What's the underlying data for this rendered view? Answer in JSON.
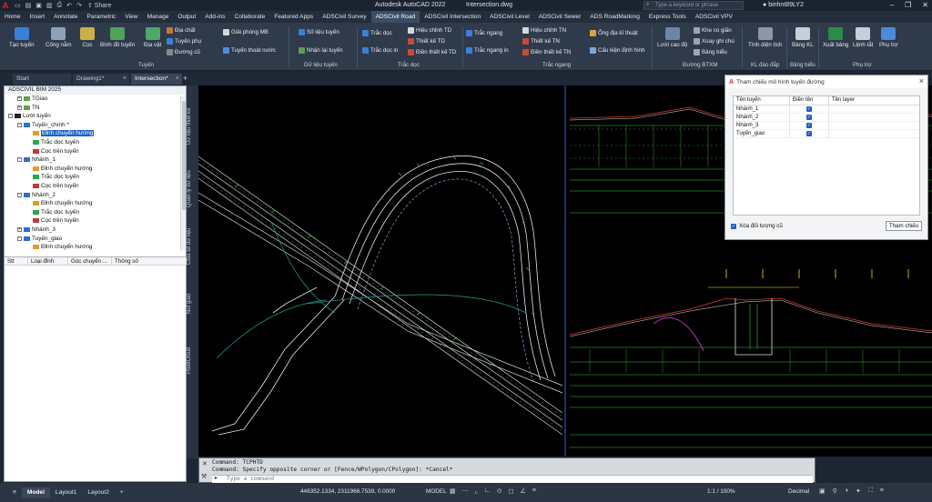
{
  "app": {
    "title": "Autodesk AutoCAD 2022",
    "file": "Intersection.dwg",
    "share": "Share",
    "search_placeholder": "Type a keyword or phrase",
    "user": "binhnt89LY2"
  },
  "ribbon_tabs": [
    "Home",
    "Insert",
    "Annotate",
    "Parametric",
    "View",
    "Manage",
    "Output",
    "Add-ins",
    "Collaborate",
    "Featured Apps",
    "ADSCivil Survey",
    "ADSCivil Road",
    "ADSCivil Intersection",
    "ADSCivil Level",
    "ADSCivil Sewer",
    "ADS RoadMarking",
    "Express Tools",
    "ADSCivil VPV"
  ],
  "active_ribbon_tab": "ADSCivil Road",
  "ribbon": {
    "tao_tuyen": "Tạo tuyến",
    "cong_nam": "Cống nằm",
    "coc": "Cọc",
    "binh_do_tuyen": "Bình đồ tuyến",
    "dia_vat": "Địa vật",
    "dia_chat": "Địa chất",
    "tuyen_phu": "Tuyến phụ",
    "duong_cu": "Đường cũ",
    "giai_phong_mb": "Giải phóng MB",
    "tuyen_thoat_nuoc": "Tuyến thoát nước",
    "so_lieu_tuyen": "Số liệu tuyến",
    "nhan_lai_tuyen": "Nhận lại tuyến",
    "trac_doc": "Trắc dọc",
    "trac_doc_in": "Trắc dọc in",
    "hieu_chinh_td": "Hiệu chỉnh TD",
    "thiet_ke_td": "Thiết kế TD",
    "dien_thiet_ke_td": "Điền thiết kế TD",
    "trac_ngang": "Trắc ngang",
    "trac_ngang_in": "Trắc ngang in",
    "hieu_chinh_tn": "Hiệu chỉnh TN",
    "thiet_ke_tn": "Thiết kế TN",
    "dien_thiet_ke_tn": "Điền thiết kế TN",
    "ong_dia_ki_thuat": "Ống địa kĩ thuật",
    "cau_kien_dinh_hinh": "Cấu kiện định hình",
    "luoi_cao_do": "Lưới cao độ",
    "khe_co_gian": "Khe co giãn",
    "xoay_ghi_chu": "Xoay ghi chú",
    "bang_bieu": "Bảng biểu",
    "tinh_dien_tich": "Tính diện tích",
    "bang_kl": "Bảng KL",
    "xuat_bang": "Xuất bảng",
    "lenh_tat": "Lệnh tắt",
    "phu_tro": "Phụ trợ",
    "groups": {
      "tuyen": "Tuyến",
      "du_lieu_tuyen": "Dữ liệu tuyến",
      "trac_doc": "Trắc dọc",
      "trac_ngang": "Trắc ngang",
      "duong_btxm": "Đường BTXM",
      "kl_dao_dap": "KL đào đắp",
      "bang_bieu": "Bảng biểu",
      "phu_tro": "Phụ trợ"
    }
  },
  "doc_tabs": [
    "Start",
    "Drawing1*",
    "Intersection*"
  ],
  "active_doc_tab": "Intersection*",
  "left_panel": {
    "title": "ADSCIVIL BIM 2025",
    "tree": [
      {
        "label": "TGiao",
        "indent": 1,
        "toggle": "+",
        "icon": "green"
      },
      {
        "label": "TN",
        "indent": 1,
        "toggle": "+",
        "icon": "green"
      },
      {
        "label": "Lưới tuyến",
        "indent": 0,
        "toggle": "-",
        "icon": "black"
      },
      {
        "label": "Tuyến_chính *",
        "indent": 1,
        "toggle": "-",
        "icon": "route"
      },
      {
        "label": "Đỉnh chuyển hướng",
        "indent": 2,
        "toggle": "",
        "icon": "curve",
        "selected": true
      },
      {
        "label": "Trắc dọc tuyến",
        "indent": 2,
        "toggle": "",
        "icon": "profile"
      },
      {
        "label": "Cọc trên tuyến",
        "indent": 2,
        "toggle": "",
        "icon": "stake"
      },
      {
        "label": "Nhánh_1",
        "indent": 1,
        "toggle": "-",
        "icon": "route"
      },
      {
        "label": "Đỉnh chuyển hướng",
        "indent": 2,
        "toggle": "",
        "icon": "curve"
      },
      {
        "label": "Trắc dọc tuyến",
        "indent": 2,
        "toggle": "",
        "icon": "profile"
      },
      {
        "label": "Cọc trên tuyến",
        "indent": 2,
        "toggle": "",
        "icon": "stake"
      },
      {
        "label": "Nhánh_2",
        "indent": 1,
        "toggle": "-",
        "icon": "route"
      },
      {
        "label": "Đỉnh chuyển hướng",
        "indent": 2,
        "toggle": "",
        "icon": "curve"
      },
      {
        "label": "Trắc dọc tuyến",
        "indent": 2,
        "toggle": "",
        "icon": "profile"
      },
      {
        "label": "Cọc trên tuyến",
        "indent": 2,
        "toggle": "",
        "icon": "stake"
      },
      {
        "label": "Nhánh_3",
        "indent": 1,
        "toggle": "+",
        "icon": "route"
      },
      {
        "label": "Tuyến_giao",
        "indent": 1,
        "toggle": "-",
        "icon": "route"
      },
      {
        "label": "Đỉnh chuyển hướng",
        "indent": 2,
        "toggle": "",
        "icon": "curve"
      }
    ],
    "table_headers": [
      "Stt",
      "Loại đỉnh",
      "Góc chuyển ...",
      "Thông số"
    ]
  },
  "side_labels": [
    "Dữ liệu thiết kế",
    "Quản lý dữ liệu",
    "Chia sẻ dữ liệu",
    "Nút giao",
    "PointCloud"
  ],
  "dialog": {
    "title": "Tham chiếu mô hình tuyến đường",
    "headers": [
      "Tên tuyến",
      "Điền tên",
      "Tên layer"
    ],
    "rows": [
      {
        "name": "Nhánh_1",
        "checked": true
      },
      {
        "name": "Nhánh_2",
        "checked": true
      },
      {
        "name": "Nhánh_3",
        "checked": true
      },
      {
        "name": "Tuyến_giao",
        "checked": true
      }
    ],
    "delete_old_label": "Xóa đối tượng cũ",
    "ok_button": "Tham chiếu"
  },
  "command": {
    "line1": "Command: TCPHTD",
    "line2": "Command: Specify opposite corner or [Fence/WPolygon/CPolygon]: *Cancel*",
    "placeholder": "Type a command"
  },
  "status": {
    "layout_tabs": [
      "Model",
      "Layout1",
      "Layout2"
    ],
    "coords": "446352.1334, 2311966.7539, 0.0000",
    "model": "MODEL",
    "scale": "1:1 / 100%",
    "units": "Decimal"
  }
}
